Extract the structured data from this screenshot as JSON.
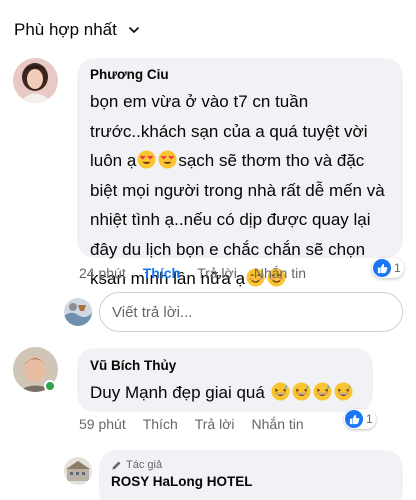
{
  "sort": {
    "label": "Phù hợp nhất",
    "icon": "chevron-down-icon"
  },
  "comments": [
    {
      "author": "Phương Ciu",
      "lines": [
        "bọn em vừa ở vào t7 cn tuần",
        "trước..khách sạn của a quá tuyệt vời",
        "sạch sẽ thơm tho và đặc",
        "biệt mọi người trong nhà rất dễ mến và",
        "nhiệt tình ạ..nếu có dịp được quay lại",
        "đây du lịch bọn e chắc chắn sẽ chọn",
        "ksan mình lần nữa ạ"
      ],
      "line3_prefix": "luôn ạ",
      "emojis_line3": [
        "heart-eyes-emoji",
        "heart-eyes-emoji"
      ],
      "emojis_line7": [
        "smiling-emoji",
        "smiling-emoji"
      ],
      "time": "24 phút",
      "like_label": "Thích",
      "reply_label": "Trả lời",
      "message_label": "Nhắn tin",
      "reaction_count": "1",
      "liked": true
    },
    {
      "author": "Vũ Bích Thủy",
      "text": "Duy Mạnh đẹp giai quá",
      "emojis": [
        "grin-sweat-emoji",
        "grin-sweat-emoji",
        "grin-sweat-emoji",
        "grin-sweat-emoji"
      ],
      "time": "59 phút",
      "like_label": "Thích",
      "reply_label": "Trả lời",
      "message_label": "Nhắn tin",
      "reaction_count": "1",
      "liked": false
    }
  ],
  "reply_box": {
    "placeholder": "Viết trả lời..."
  },
  "page_reply": {
    "badge": "Tác giả",
    "badge_icon": "pencil-icon",
    "name": "ROSY HaLong HOTEL"
  },
  "colors": {
    "accent": "#1877f2",
    "bubble": "#f0f2f5",
    "muted": "#65676b",
    "online": "#31a24c"
  }
}
